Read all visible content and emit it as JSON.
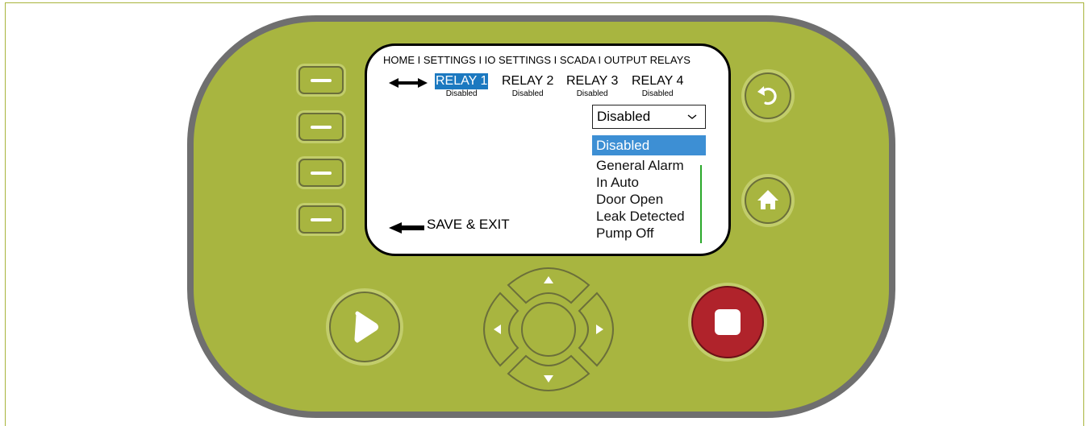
{
  "screen": {
    "breadcrumb": "HOME I SETTINGS I IO SETTINGS I SCADA I OUTPUT RELAYS",
    "relays": [
      {
        "label": "RELAY 1",
        "status": "Disabled",
        "selected": true
      },
      {
        "label": "RELAY 2",
        "status": "Disabled",
        "selected": false
      },
      {
        "label": "RELAY 3",
        "status": "Disabled",
        "selected": false
      },
      {
        "label": "RELAY 4",
        "status": "Disabled",
        "selected": false
      }
    ],
    "select": {
      "value": "Disabled"
    },
    "options": [
      "Disabled",
      "General Alarm",
      "In Auto",
      "Door Open",
      "Leak Detected",
      "Pump Off"
    ],
    "active_option": "Disabled",
    "save_exit_label": "SAVE & EXIT"
  },
  "icons": {
    "left_right_arrow": "left-right-arrow-icon",
    "left_arrow": "left-arrow-icon",
    "back": "back-icon",
    "home": "home-icon",
    "play": "play-icon",
    "stop": "stop-icon",
    "dpad": [
      "up-arrow-icon",
      "down-arrow-icon",
      "left-arrow-icon",
      "right-arrow-icon"
    ]
  },
  "colors": {
    "device_body": "#a8b540",
    "device_border": "#6f6f6f",
    "selected_relay": "#1c79c0",
    "selected_option": "#3d8fd4",
    "stop_button": "#b0232b",
    "scrollbar": "#2aa82a"
  }
}
